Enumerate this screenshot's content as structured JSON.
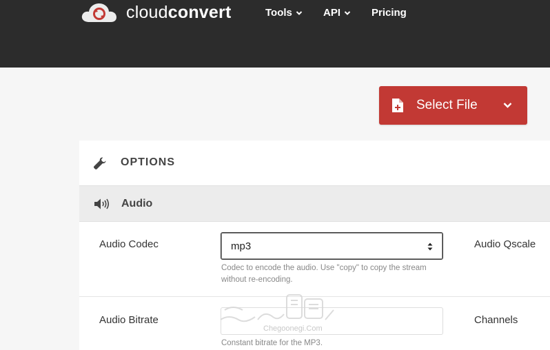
{
  "brand": {
    "name_light": "cloud",
    "name_bold": "convert"
  },
  "nav": {
    "items": [
      {
        "label": "Tools",
        "has_dropdown": true
      },
      {
        "label": "API",
        "has_dropdown": true
      },
      {
        "label": "Pricing",
        "has_dropdown": false
      }
    ]
  },
  "select_file": {
    "label": "Select File"
  },
  "options": {
    "title": "OPTIONS"
  },
  "audio": {
    "title": "Audio",
    "fields": {
      "codec": {
        "label": "Audio Codec",
        "value": "mp3",
        "help": "Codec to encode the audio. Use \"copy\" to copy the stream without re-encoding."
      },
      "qscale": {
        "label": "Audio Qscale"
      },
      "bitrate": {
        "label": "Audio Bitrate",
        "value": "",
        "help": "Constant bitrate for the MP3."
      },
      "channels": {
        "label": "Channels"
      }
    }
  },
  "watermark": {
    "text": "Chegoonegi.Com"
  },
  "colors": {
    "topbar": "#2c2c2c",
    "accent": "#c23934",
    "panel": "#ffffff",
    "section": "#ececec"
  }
}
